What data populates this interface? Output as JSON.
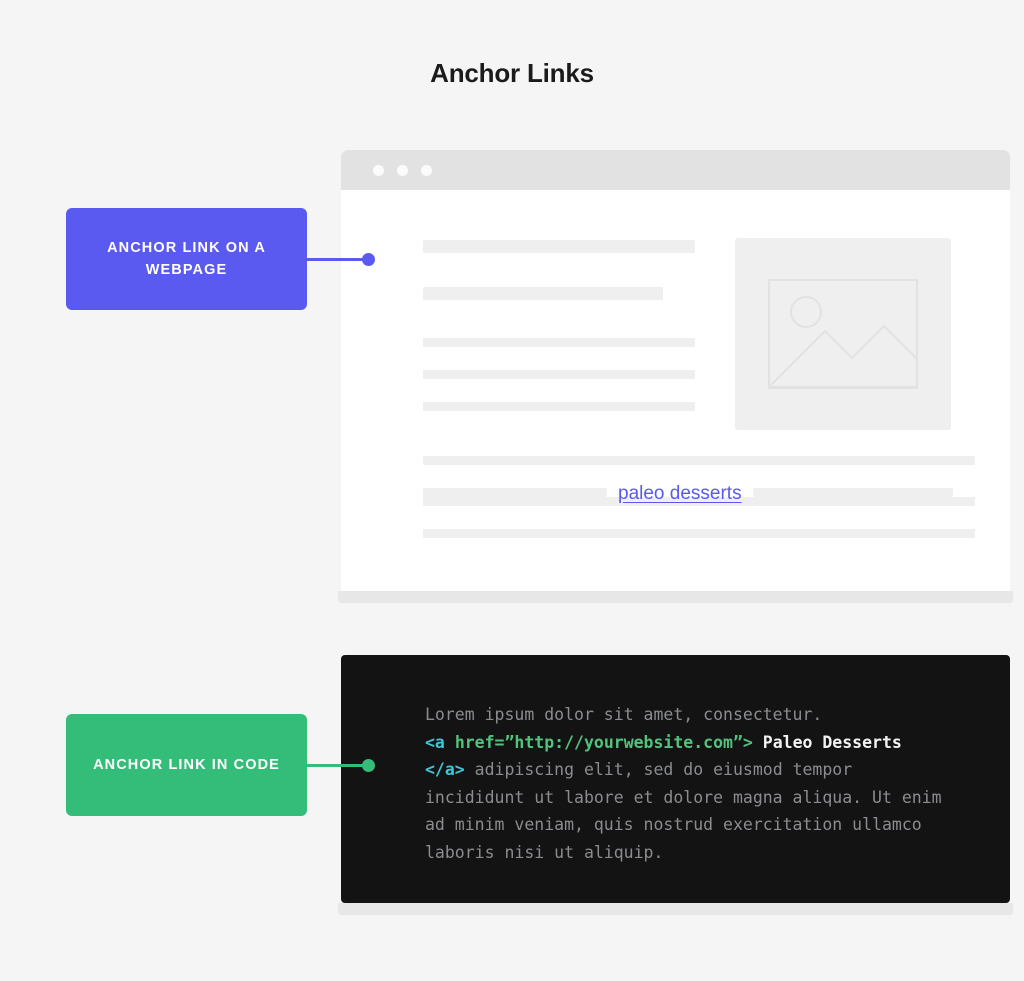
{
  "page": {
    "title": "Anchor Links",
    "background_color": "#f5f5f5"
  },
  "colors": {
    "purple": "#5a5af0",
    "green": "#33bd78",
    "code_background": "#131313",
    "skeleton": "#efefef",
    "titlebar": "#e2e2e2"
  },
  "badges": {
    "webpage": {
      "label": "ANCHOR LINK ON A WEBPAGE",
      "color": "#5a5af0"
    },
    "code": {
      "label": "ANCHOR LINK IN CODE",
      "color": "#33bd78"
    }
  },
  "browser": {
    "window_controls": [
      "dot-1",
      "dot-2",
      "dot-3"
    ],
    "anchor_link_text": "paleo desserts",
    "anchor_link_color": "#5a5af0",
    "image_placeholder": "image-placeholder-icon"
  },
  "code": {
    "line1": "Lorem ipsum dolor sit amet, consectetur.",
    "tag_open": "<a ",
    "attribute": "href=”http://yourwebsite.com”>",
    "link_text": " Paleo Desserts ",
    "tag_close": "</a>",
    "tail": " adipiscing elit, sed do eiusmod tempor incididunt ut labore et dolore magna aliqua. Ut enim ad minim veniam, quis nostrud exercitation ullamco laboris nisi ut aliquip."
  }
}
